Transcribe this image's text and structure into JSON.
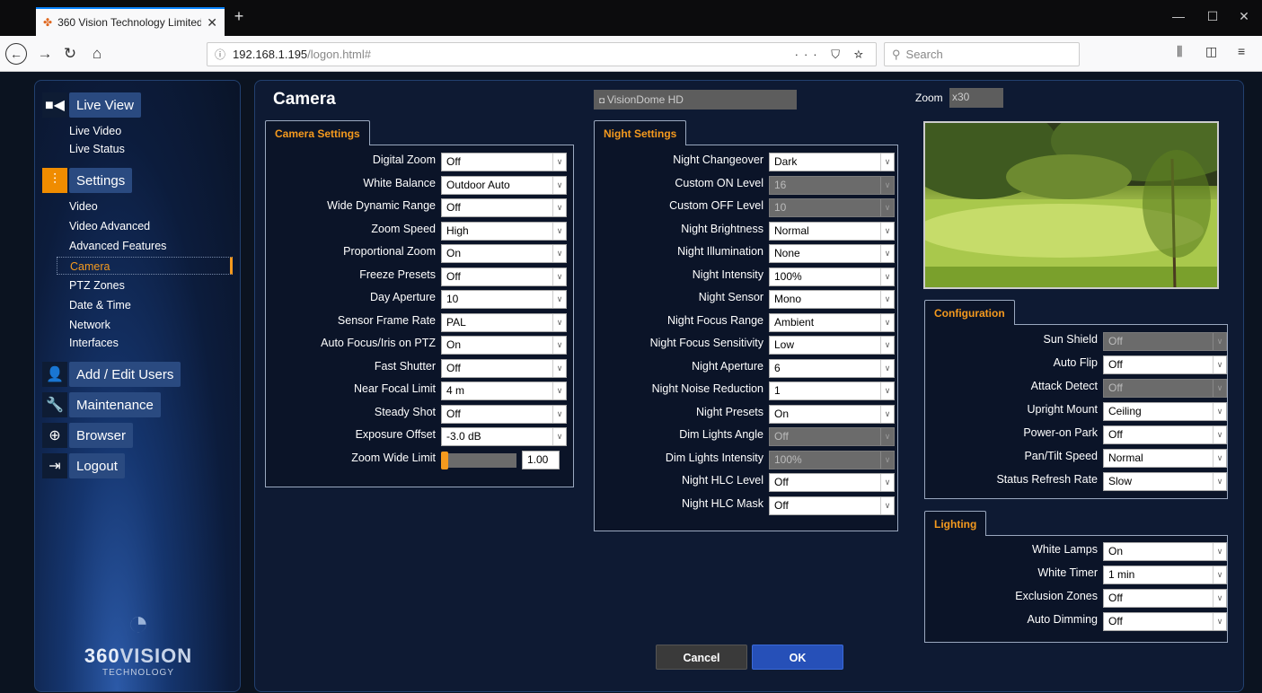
{
  "browser": {
    "tab_title": "360 Vision Technology Limited",
    "url_host": "192.168.1.195",
    "url_path": "/logon.html#",
    "search_placeholder": "Search"
  },
  "sidebar": {
    "groups": [
      {
        "label": "Live View",
        "icon": "video-camera-icon",
        "items": [
          "Live Video",
          "Live Status"
        ]
      },
      {
        "label": "Settings",
        "icon": "sliders-icon",
        "items": [
          "Video",
          "Video Advanced",
          "Advanced Features",
          "Camera",
          "PTZ Zones",
          "Date & Time",
          "Network",
          "Interfaces"
        ]
      },
      {
        "label": "Add / Edit Users",
        "icon": "add-user-icon",
        "items": []
      },
      {
        "label": "Maintenance",
        "icon": "wrench-icon",
        "items": []
      },
      {
        "label": "Browser",
        "icon": "globe-icon",
        "items": []
      },
      {
        "label": "Logout",
        "icon": "logout-icon",
        "items": []
      }
    ],
    "selected_item": "Camera",
    "logo_brand_a": "360",
    "logo_brand_b": "VISION",
    "logo_sub": "TECHNOLOGY"
  },
  "main": {
    "title": "Camera",
    "camera_name": "VisionDome HD",
    "zoom_label": "Zoom",
    "zoom_value": "x30",
    "cancel_label": "Cancel",
    "ok_label": "OK"
  },
  "camera_settings": {
    "tab": "Camera Settings",
    "rows": [
      {
        "label": "Digital Zoom",
        "value": "Off"
      },
      {
        "label": "White Balance",
        "value": "Outdoor Auto"
      },
      {
        "label": "Wide Dynamic Range",
        "value": "Off"
      },
      {
        "label": "Zoom Speed",
        "value": "High"
      },
      {
        "label": "Proportional Zoom",
        "value": "On"
      },
      {
        "label": "Freeze Presets",
        "value": "Off"
      },
      {
        "label": "Day Aperture",
        "value": "10"
      },
      {
        "label": "Sensor Frame Rate",
        "value": "PAL"
      },
      {
        "label": "Auto Focus/Iris on PTZ",
        "value": "On"
      },
      {
        "label": "Fast Shutter",
        "value": "Off"
      },
      {
        "label": "Near Focal Limit",
        "value": "4 m"
      },
      {
        "label": "Steady Shot",
        "value": "Off"
      },
      {
        "label": "Exposure Offset",
        "value": "-3.0 dB"
      }
    ],
    "zoom_wide_label": "Zoom Wide Limit",
    "zoom_wide_value": "1.00",
    "zoom_wide_fraction": 0.0
  },
  "night_settings": {
    "tab": "Night Settings",
    "rows": [
      {
        "label": "Night Changeover",
        "value": "Dark",
        "disabled": false
      },
      {
        "label": "Custom ON Level",
        "value": "16",
        "disabled": true
      },
      {
        "label": "Custom OFF Level",
        "value": "10",
        "disabled": true
      },
      {
        "label": "Night Brightness",
        "value": "Normal",
        "disabled": false
      },
      {
        "label": "Night Illumination",
        "value": "None",
        "disabled": false
      },
      {
        "label": "Night Intensity",
        "value": "100%",
        "disabled": false
      },
      {
        "label": "Night Sensor",
        "value": "Mono",
        "disabled": false
      },
      {
        "label": "Night Focus Range",
        "value": "Ambient",
        "disabled": false
      },
      {
        "label": "Night Focus Sensitivity",
        "value": "Low",
        "disabled": false
      },
      {
        "label": "Night Aperture",
        "value": "6",
        "disabled": false
      },
      {
        "label": "Night Noise Reduction",
        "value": "1",
        "disabled": false
      },
      {
        "label": "Night Presets",
        "value": "On",
        "disabled": false
      },
      {
        "label": "Dim Lights Angle",
        "value": "Off",
        "disabled": true
      },
      {
        "label": "Dim Lights Intensity",
        "value": "100%",
        "disabled": true
      },
      {
        "label": "Night HLC Level",
        "value": "Off",
        "disabled": false
      },
      {
        "label": "Night HLC Mask",
        "value": "Off",
        "disabled": false
      }
    ]
  },
  "configuration": {
    "tab": "Configuration",
    "rows": [
      {
        "label": "Sun Shield",
        "value": "Off",
        "disabled": true
      },
      {
        "label": "Auto Flip",
        "value": "Off",
        "disabled": false
      },
      {
        "label": "Attack Detect",
        "value": "Off",
        "disabled": true
      },
      {
        "label": "Upright Mount",
        "value": "Ceiling",
        "disabled": false
      },
      {
        "label": "Power-on Park",
        "value": "Off",
        "disabled": false
      },
      {
        "label": "Pan/Tilt Speed",
        "value": "Normal",
        "disabled": false
      },
      {
        "label": "Status Refresh Rate",
        "value": "Slow",
        "disabled": false
      }
    ]
  },
  "lighting": {
    "tab": "Lighting",
    "rows": [
      {
        "label": "White Lamps",
        "value": "On",
        "disabled": false
      },
      {
        "label": "White Timer",
        "value": "1 min",
        "disabled": false
      },
      {
        "label": "Exclusion Zones",
        "value": "Off",
        "disabled": false
      },
      {
        "label": "Auto Dimming",
        "value": "Off",
        "disabled": false
      }
    ]
  },
  "colors": {
    "accent": "#f59a1e",
    "ok_button": "#2650b8",
    "cancel_button": "#3a3a3a",
    "panel_border": "#9aa8bf"
  }
}
